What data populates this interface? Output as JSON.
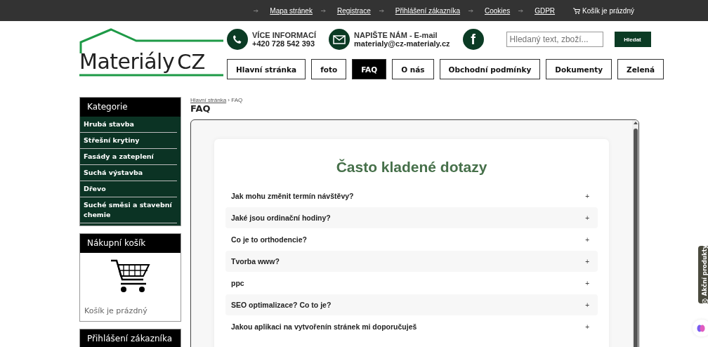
{
  "top_links": [
    "Mapa stránek",
    "Registrace",
    "Přihlášení zákazníka",
    "Cookies",
    "GDPR"
  ],
  "cart_status": "Košík je prázdný",
  "logo": {
    "main": "Materiály",
    "suffix": "CZ"
  },
  "contacts": [
    {
      "kind": "phone",
      "title": "VÍCE INFORMACÍ",
      "value": "+420 728 542 393"
    },
    {
      "kind": "email",
      "title": "NAPIŠTE NÁM - E-mail",
      "value": "materialy@cz-materialy.cz"
    }
  ],
  "social": {
    "label": "f"
  },
  "search": {
    "placeholder": "Hledaný text, zboží...",
    "button": "Hledat"
  },
  "nav": [
    {
      "label": "Hlavní stránka",
      "selected": false
    },
    {
      "label": "foto",
      "selected": false
    },
    {
      "label": "FAQ",
      "selected": true
    },
    {
      "label": "O nás",
      "selected": false
    },
    {
      "label": "Obchodní podmínky",
      "selected": false
    },
    {
      "label": "Dokumenty",
      "selected": false
    },
    {
      "label": "Zelená",
      "selected": false
    }
  ],
  "sidebar": {
    "categories_title": "Kategorie",
    "categories": [
      "Hrubá stavba",
      "Střešní krytiny",
      "Fasády a zateplení",
      "Suchá výstavba",
      "Dřevo",
      "Suché směsi a stavební chemie"
    ],
    "cart_title": "Nákupní košík",
    "cart_text": "Košík je prázdný",
    "login_title": "Přihlášení zákazníka"
  },
  "breadcrumb": [
    "Hlavní stránka",
    "FAQ"
  ],
  "breadcrumb_separator": "›",
  "page_title": "FAQ",
  "faq": {
    "title": "Často kladené dotazy",
    "items": [
      {
        "question": "Jak mohu změnit termín návštěvy?",
        "toggle": "+"
      },
      {
        "question": "Jaké jsou ordinační hodiny?",
        "toggle": "+"
      },
      {
        "question": "Co je to orthodencie?",
        "toggle": "+"
      },
      {
        "question": "Tvorba www?",
        "toggle": "+"
      },
      {
        "question": "ppc",
        "toggle": "+"
      },
      {
        "question": "SEO optimalizace? Co to je?",
        "toggle": "+"
      },
      {
        "question": "Jakou aplikaci na vytvořenín stránek mi doporučuješ",
        "toggle": "+"
      }
    ]
  },
  "side_tab": "Akční produkty"
}
